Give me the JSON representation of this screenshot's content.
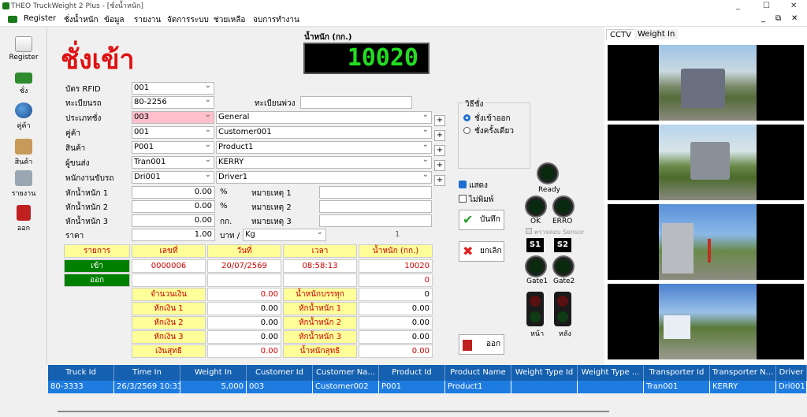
{
  "window": {
    "title": "THEO TruckWeight 2 Plus - [ชั่งน้ำหนัก]",
    "controls": [
      "_",
      "☐",
      "✕"
    ],
    "inner_controls": [
      "_",
      "⧉",
      "✕"
    ]
  },
  "menu": [
    "Register",
    "ชั่งน้ำหนัก",
    "ข้อมูล",
    "รายงาน",
    "จัดการระบบ",
    "ช่วยเหลือ",
    "จบการทำงาน"
  ],
  "sidebar": [
    {
      "label": "Register",
      "icon": "register-icon"
    },
    {
      "label": "ชั่ง",
      "icon": "truck-icon"
    },
    {
      "label": "คู่ค้า",
      "icon": "partner-icon"
    },
    {
      "label": "สินค้า",
      "icon": "box-icon"
    },
    {
      "label": "รายงาน",
      "icon": "printer-icon"
    },
    {
      "label": "ออก",
      "icon": "exit-icon"
    }
  ],
  "page_title": "ชั่งเข้า",
  "weight": {
    "label": "น้ำหนัก (กก.)",
    "value": "10020"
  },
  "form": {
    "rfid": {
      "label": "บัตร RFID",
      "value": "001"
    },
    "plate": {
      "label": "ทะเบียนรถ",
      "value": "80-2256"
    },
    "trailer": {
      "label": "ทะเบียนพ่วง",
      "value": ""
    },
    "type": {
      "label": "ประเภทชั่ง",
      "code": "003",
      "name": "General"
    },
    "partner": {
      "label": "คู่ค้า",
      "code": "001",
      "name": "Customer001"
    },
    "product": {
      "label": "สินค้า",
      "code": "P001",
      "name": "Product1"
    },
    "transporter": {
      "label": "ผู้ขนส่ง",
      "code": "Tran001",
      "name": "KERRY"
    },
    "driver": {
      "label": "พนักงานขับรถ",
      "code": "Dri001",
      "name": "Driver1"
    },
    "d1": {
      "label": "หักน้ำหนัก 1",
      "value": "0.00",
      "unit": "%",
      "note": "หมายเหตุ 1"
    },
    "d2": {
      "label": "หักน้ำหนัก 2",
      "value": "0.00",
      "unit": "%",
      "note": "หมายเหตุ 2"
    },
    "d3": {
      "label": "หักน้ำหนัก 3",
      "value": "0.00",
      "unit": "กก.",
      "note": "หมายเหตุ 3"
    },
    "price": {
      "label": "ราคา",
      "value": "1.00",
      "unit": "บาท /",
      "per": "Kg",
      "count": "1"
    }
  },
  "method": {
    "title": "วิธีชั่ง",
    "opt1": "ชั่งเข้าออก",
    "opt2": "ชั่งครั้งเดียว"
  },
  "checks": {
    "show": "แสดง",
    "noprint": "ไม่พิมพ์"
  },
  "buttons": {
    "save": "บันทึก",
    "cancel": "ยกเลิก",
    "exit": "ออก"
  },
  "lights": {
    "ready": "Ready",
    "ok": "OK",
    "err": "ERRO",
    "sensor": "ตรวจสอบ Sensor",
    "s1": "S1",
    "s2": "S2",
    "gate1": "Gate1",
    "gate2": "Gate2",
    "front": "หน้า",
    "back": "หลัง"
  },
  "table": {
    "headers": [
      "รายการ",
      "เลขที่",
      "วันที่",
      "เวลา",
      "น้ำหนัก (กก.)"
    ],
    "in": {
      "label": "เข้า",
      "no": "0000006",
      "date": "20/07/2569",
      "time": "08:58:13",
      "weight": "10020"
    },
    "out": {
      "label": "ออก",
      "weight": "0"
    },
    "money": [
      {
        "label": "จำนวนเงิน",
        "value": "0.00"
      },
      {
        "label": "หักเงิน 1",
        "value": "0.00"
      },
      {
        "label": "หักเงิน 2",
        "value": "0.00"
      },
      {
        "label": "หักเงิน 3",
        "value": "0.00"
      },
      {
        "label": "เงินสุทธิ",
        "value": "0.00"
      }
    ],
    "wts": [
      {
        "label": "น้ำหนักบรรทุก",
        "value": "0"
      },
      {
        "label": "หักน้ำหนัก 1",
        "value": "0.00"
      },
      {
        "label": "หักน้ำหนัก 2",
        "value": "0.00"
      },
      {
        "label": "หักน้ำหนัก 3",
        "value": "0.00"
      },
      {
        "label": "น้ำหนักสุทธิ",
        "value": "0.00"
      }
    ]
  },
  "tabs": [
    "CCTV",
    "Weight In"
  ],
  "grid": {
    "headers": [
      "Truck Id",
      "Time In",
      "Weight In",
      "Customer Id",
      "Customer Na...",
      "Product Id",
      "Product Name",
      "Weight Type Id",
      "Weight Type ...",
      "Transporter Id",
      "Transporter N...",
      "Driver"
    ],
    "row": [
      "80-3333",
      "26/3/2569 10:33",
      "5,000",
      "003",
      "Customer002",
      "P001",
      "Product1",
      "",
      "",
      "Tran001",
      "KERRY",
      "Dri001"
    ]
  },
  "colors": {
    "title_red": "#e01010",
    "digits": "#22dd22",
    "grid_header": "#1560b0",
    "row_selected": "#1e7be0",
    "green_button": "#008000"
  }
}
